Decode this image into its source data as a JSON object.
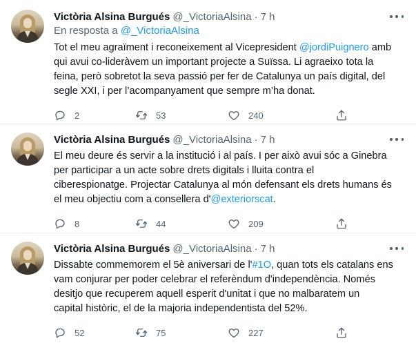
{
  "tweets": [
    {
      "author_name": "Victòria Alsina Burgués",
      "author_handle": "@_VictoriaAlsina",
      "separator": "·",
      "time": "7 h",
      "reply_prefix": "En resposta a",
      "reply_handle": "@_VictoriaAlsina",
      "lines": [
        [
          {
            "t": "Tot el meu agraïment i reconeixement al Vicepresident "
          },
          {
            "t": "@jordiPuignero",
            "link": true
          },
          {
            "t": " amb"
          }
        ],
        [
          {
            "t": "qui avui co-lideràvem un important projecte a Suïssa. Li agraeixo tota la"
          }
        ],
        [
          {
            "t": "feina, però sobretot la seva passió per fer de Catalunya un país digital, del"
          }
        ],
        [
          {
            "t": "segle XXI, i per l’acompanyament que sempre m’ha donat."
          }
        ]
      ],
      "replies": "2",
      "retweets": "53",
      "likes": "240"
    },
    {
      "author_name": "Victòria Alsina Burgués",
      "author_handle": "@_VictoriaAlsina",
      "separator": "·",
      "time": "7 h",
      "lines": [
        [
          {
            "t": "El meu deure és servir a la institució i al país. I per això avui sóc a Ginebra"
          }
        ],
        [
          {
            "t": "per participar a un acte sobre drets digitals i lluita contra el"
          }
        ],
        [
          {
            "t": "ciberespionatge. Projectar Catalunya al món defensant els drets humans és"
          }
        ],
        [
          {
            "t": "el meu objectiu com a consellera d'"
          },
          {
            "t": "@exteriorscat",
            "link": true
          },
          {
            "t": "."
          }
        ]
      ],
      "replies": "8",
      "retweets": "44",
      "likes": "209"
    },
    {
      "author_name": "Victòria Alsina Burgués",
      "author_handle": "@_VictoriaAlsina",
      "separator": "·",
      "time": "7 h",
      "lines": [
        [
          {
            "t": "Dissabte commemorem el 5è aniversari de l'"
          },
          {
            "t": "#1O",
            "link": true
          },
          {
            "t": ", quan tots els catalans ens"
          }
        ],
        [
          {
            "t": "vam conjurar per poder celebrar el referèndum d'independència. Només"
          }
        ],
        [
          {
            "t": "desitjo que recuperem aquell esperit d'unitat i que no malbaratem un"
          }
        ],
        [
          {
            "t": "capital històric, el de la majoria independentista del 52%."
          }
        ]
      ],
      "replies": "52",
      "retweets": "75",
      "likes": "227"
    }
  ],
  "icons": {
    "reply": "speech-bubble-icon",
    "retweet": "retweet-arrows-icon",
    "like": "heart-icon",
    "share": "share-upload-icon",
    "more": "more-dots-icon"
  },
  "colors": {
    "text": "#0f1419",
    "secondary": "#536471",
    "link": "#1d9bf0",
    "divider": "#eff3f4"
  }
}
